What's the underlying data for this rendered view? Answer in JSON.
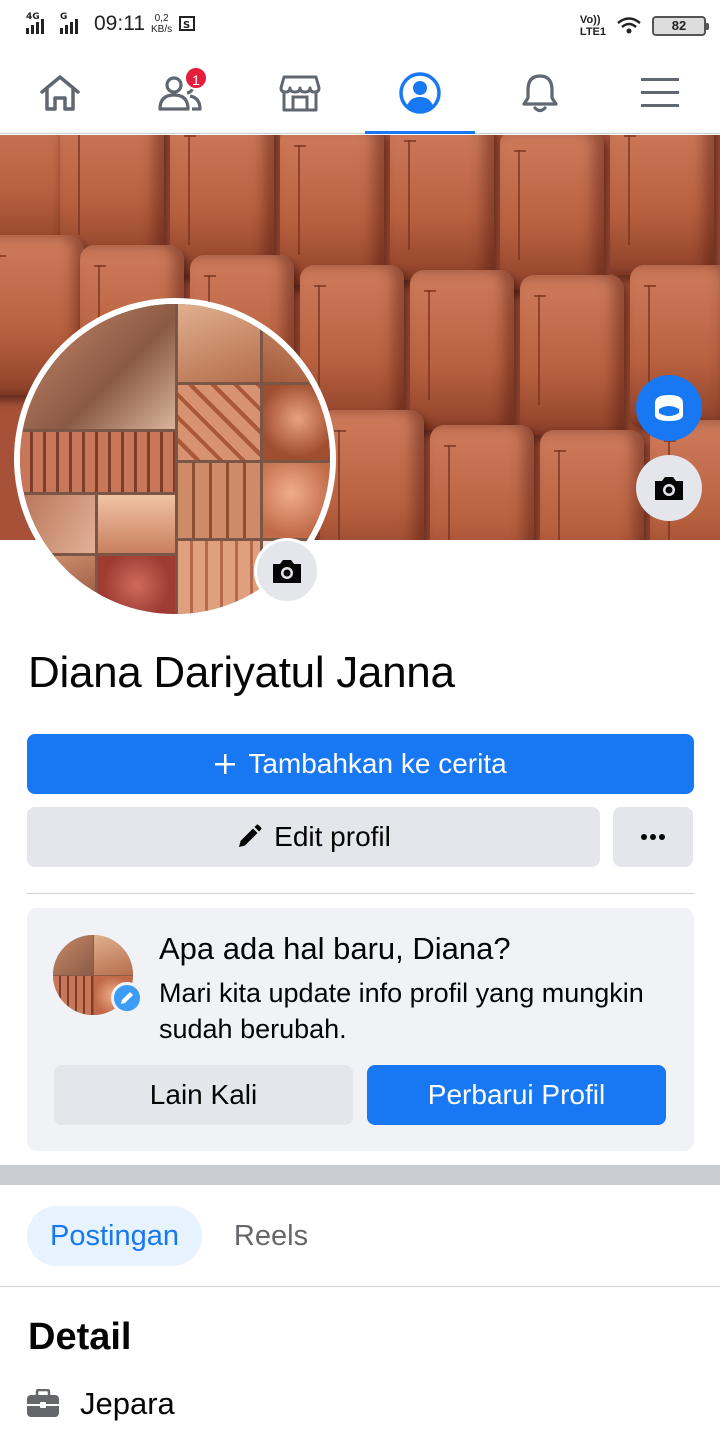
{
  "status_bar": {
    "network_1": "4G",
    "network_2": "G",
    "time": "09:11",
    "speed_value": "0,2",
    "speed_unit": "KB/s",
    "volte_line1": "Vo))",
    "volte_line2": "LTE1",
    "battery": "82"
  },
  "nav": {
    "items": [
      {
        "name": "home",
        "icon": "home-icon"
      },
      {
        "name": "friends",
        "icon": "friends-icon",
        "badge": "1"
      },
      {
        "name": "marketplace",
        "icon": "marketplace-icon"
      },
      {
        "name": "profile",
        "icon": "profile-icon",
        "active": true
      },
      {
        "name": "notifications",
        "icon": "bell-icon"
      },
      {
        "name": "menu",
        "icon": "hamburger-icon"
      }
    ],
    "accent": "#1877f2"
  },
  "profile": {
    "name": "Diana Dariyatul Janna"
  },
  "actions": {
    "add_story_label": "Tambahkan ke cerita",
    "edit_profile_label": "Edit profil",
    "more_label": "···"
  },
  "update_card": {
    "title": "Apa ada hal baru, Diana?",
    "subtitle": "Mari kita update info profil yang mungkin sudah berubah.",
    "later_label": "Lain Kali",
    "update_label": "Perbarui Profil"
  },
  "tabs": {
    "posts": "Postingan",
    "reels": "Reels"
  },
  "details": {
    "title": "Detail",
    "work": "Jepara"
  },
  "colors": {
    "primary": "#1877f2",
    "badge": "#e41e3f",
    "button_gray": "#e4e6eb",
    "card_bg": "#f0f2f5"
  }
}
